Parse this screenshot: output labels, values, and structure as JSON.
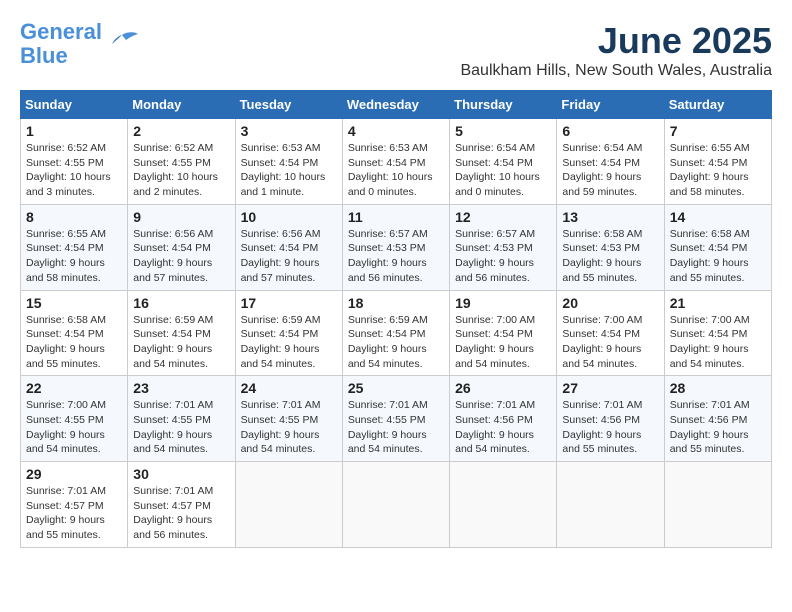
{
  "app": {
    "logo_line1": "General",
    "logo_line2": "Blue"
  },
  "header": {
    "month_title": "June 2025",
    "location": "Baulkham Hills, New South Wales, Australia"
  },
  "days_of_week": [
    "Sunday",
    "Monday",
    "Tuesday",
    "Wednesday",
    "Thursday",
    "Friday",
    "Saturday"
  ],
  "weeks": [
    [
      {
        "day": "1",
        "info": "Sunrise: 6:52 AM\nSunset: 4:55 PM\nDaylight: 10 hours\nand 3 minutes."
      },
      {
        "day": "2",
        "info": "Sunrise: 6:52 AM\nSunset: 4:55 PM\nDaylight: 10 hours\nand 2 minutes."
      },
      {
        "day": "3",
        "info": "Sunrise: 6:53 AM\nSunset: 4:54 PM\nDaylight: 10 hours\nand 1 minute."
      },
      {
        "day": "4",
        "info": "Sunrise: 6:53 AM\nSunset: 4:54 PM\nDaylight: 10 hours\nand 0 minutes."
      },
      {
        "day": "5",
        "info": "Sunrise: 6:54 AM\nSunset: 4:54 PM\nDaylight: 10 hours\nand 0 minutes."
      },
      {
        "day": "6",
        "info": "Sunrise: 6:54 AM\nSunset: 4:54 PM\nDaylight: 9 hours\nand 59 minutes."
      },
      {
        "day": "7",
        "info": "Sunrise: 6:55 AM\nSunset: 4:54 PM\nDaylight: 9 hours\nand 58 minutes."
      }
    ],
    [
      {
        "day": "8",
        "info": "Sunrise: 6:55 AM\nSunset: 4:54 PM\nDaylight: 9 hours\nand 58 minutes."
      },
      {
        "day": "9",
        "info": "Sunrise: 6:56 AM\nSunset: 4:54 PM\nDaylight: 9 hours\nand 57 minutes."
      },
      {
        "day": "10",
        "info": "Sunrise: 6:56 AM\nSunset: 4:54 PM\nDaylight: 9 hours\nand 57 minutes."
      },
      {
        "day": "11",
        "info": "Sunrise: 6:57 AM\nSunset: 4:53 PM\nDaylight: 9 hours\nand 56 minutes."
      },
      {
        "day": "12",
        "info": "Sunrise: 6:57 AM\nSunset: 4:53 PM\nDaylight: 9 hours\nand 56 minutes."
      },
      {
        "day": "13",
        "info": "Sunrise: 6:58 AM\nSunset: 4:53 PM\nDaylight: 9 hours\nand 55 minutes."
      },
      {
        "day": "14",
        "info": "Sunrise: 6:58 AM\nSunset: 4:54 PM\nDaylight: 9 hours\nand 55 minutes."
      }
    ],
    [
      {
        "day": "15",
        "info": "Sunrise: 6:58 AM\nSunset: 4:54 PM\nDaylight: 9 hours\nand 55 minutes."
      },
      {
        "day": "16",
        "info": "Sunrise: 6:59 AM\nSunset: 4:54 PM\nDaylight: 9 hours\nand 54 minutes."
      },
      {
        "day": "17",
        "info": "Sunrise: 6:59 AM\nSunset: 4:54 PM\nDaylight: 9 hours\nand 54 minutes."
      },
      {
        "day": "18",
        "info": "Sunrise: 6:59 AM\nSunset: 4:54 PM\nDaylight: 9 hours\nand 54 minutes."
      },
      {
        "day": "19",
        "info": "Sunrise: 7:00 AM\nSunset: 4:54 PM\nDaylight: 9 hours\nand 54 minutes."
      },
      {
        "day": "20",
        "info": "Sunrise: 7:00 AM\nSunset: 4:54 PM\nDaylight: 9 hours\nand 54 minutes."
      },
      {
        "day": "21",
        "info": "Sunrise: 7:00 AM\nSunset: 4:54 PM\nDaylight: 9 hours\nand 54 minutes."
      }
    ],
    [
      {
        "day": "22",
        "info": "Sunrise: 7:00 AM\nSunset: 4:55 PM\nDaylight: 9 hours\nand 54 minutes."
      },
      {
        "day": "23",
        "info": "Sunrise: 7:01 AM\nSunset: 4:55 PM\nDaylight: 9 hours\nand 54 minutes."
      },
      {
        "day": "24",
        "info": "Sunrise: 7:01 AM\nSunset: 4:55 PM\nDaylight: 9 hours\nand 54 minutes."
      },
      {
        "day": "25",
        "info": "Sunrise: 7:01 AM\nSunset: 4:55 PM\nDaylight: 9 hours\nand 54 minutes."
      },
      {
        "day": "26",
        "info": "Sunrise: 7:01 AM\nSunset: 4:56 PM\nDaylight: 9 hours\nand 54 minutes."
      },
      {
        "day": "27",
        "info": "Sunrise: 7:01 AM\nSunset: 4:56 PM\nDaylight: 9 hours\nand 55 minutes."
      },
      {
        "day": "28",
        "info": "Sunrise: 7:01 AM\nSunset: 4:56 PM\nDaylight: 9 hours\nand 55 minutes."
      }
    ],
    [
      {
        "day": "29",
        "info": "Sunrise: 7:01 AM\nSunset: 4:57 PM\nDaylight: 9 hours\nand 55 minutes."
      },
      {
        "day": "30",
        "info": "Sunrise: 7:01 AM\nSunset: 4:57 PM\nDaylight: 9 hours\nand 56 minutes."
      },
      {
        "day": "",
        "info": ""
      },
      {
        "day": "",
        "info": ""
      },
      {
        "day": "",
        "info": ""
      },
      {
        "day": "",
        "info": ""
      },
      {
        "day": "",
        "info": ""
      }
    ]
  ]
}
